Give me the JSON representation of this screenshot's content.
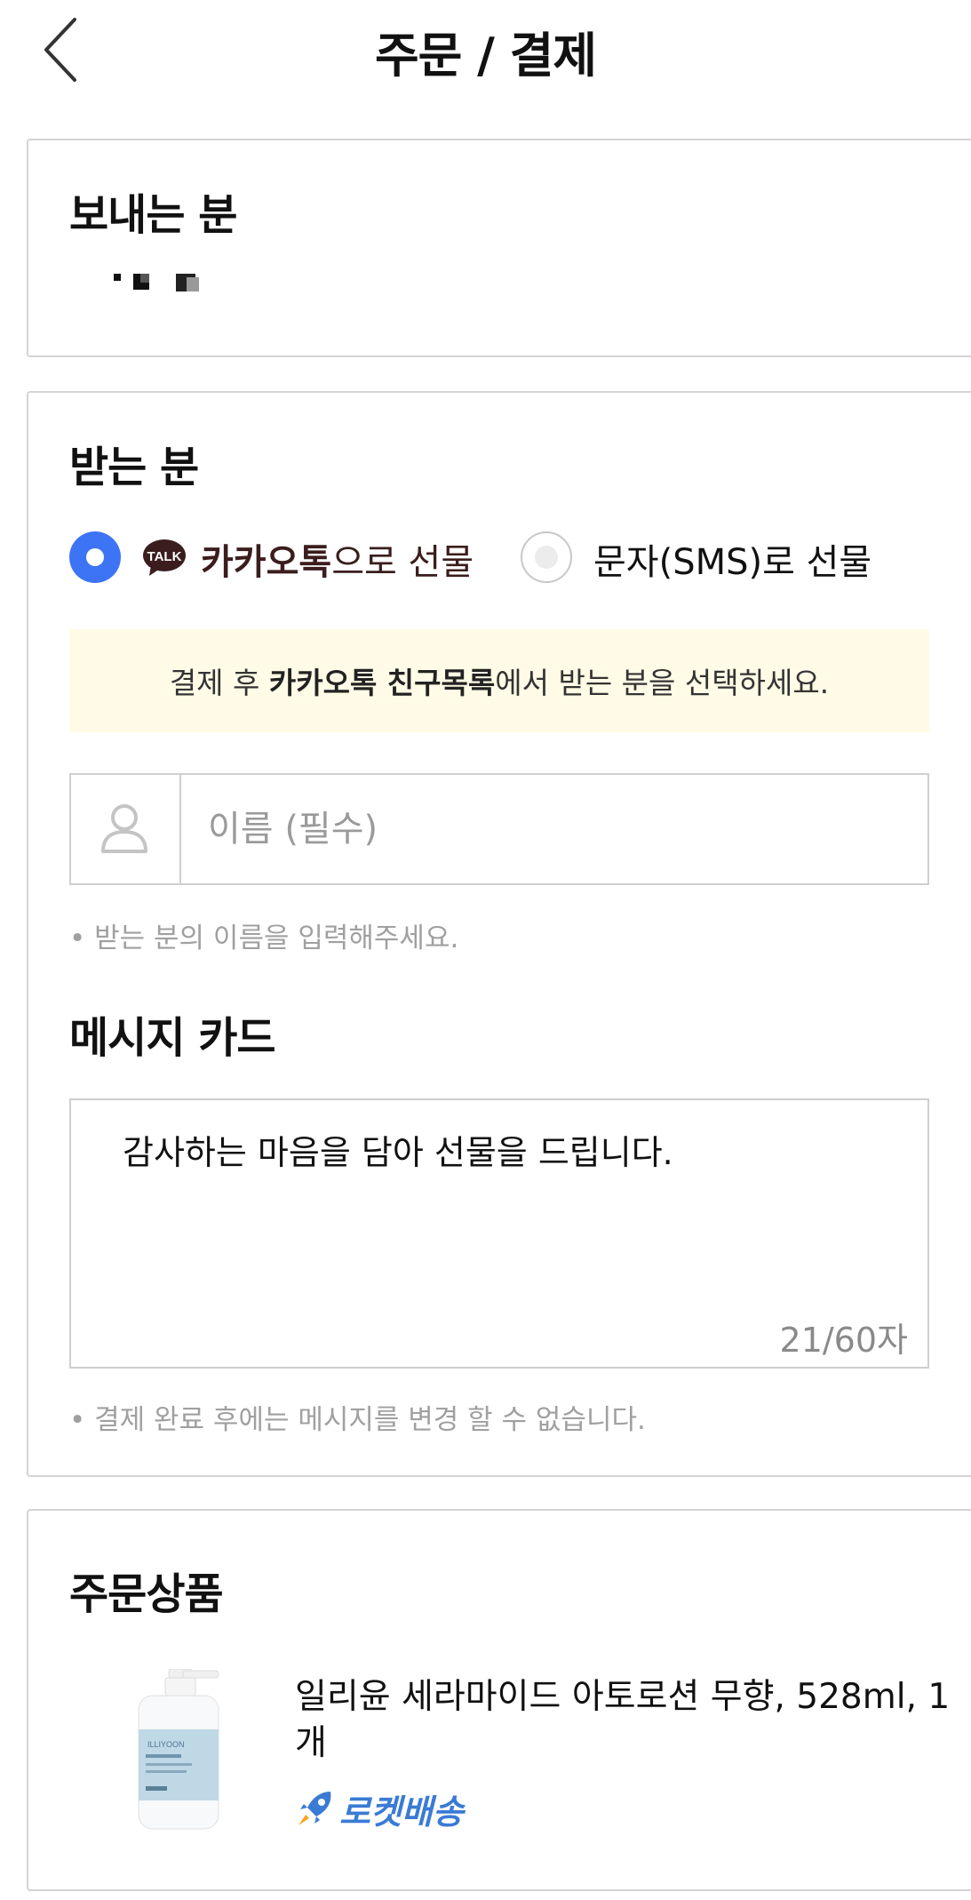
{
  "header": {
    "title": "주문 / 결제"
  },
  "sender": {
    "title": "보내는 분"
  },
  "receiver": {
    "title": "받는 분",
    "option_kakao_bold": "카카오톡",
    "option_kakao_rest": "으로 선물",
    "option_sms": "문자(SMS)로 선물",
    "talk_icon_text": "TALK",
    "selected": "kakao",
    "notice_prefix": "결제 후 ",
    "notice_bold": "카카오톡 친구목록",
    "notice_suffix": "에서 받는 분을 선택하세요.",
    "name_placeholder": "이름 (필수)",
    "name_value": "",
    "name_hint": "• 받는 분의 이름을 입력해주세요."
  },
  "message_card": {
    "title": "메시지 카드",
    "text": "감사하는 마음을 담아 선물을 드립니다.",
    "count": "21/60자",
    "hint": "• 결제 완료 후에는 메시지를 변경 할 수 없습니다."
  },
  "order": {
    "title": "주문상품",
    "product_name": "일리윤 세라마이드 아토로션 무향, 528ml, 1개",
    "delivery_badge": "로켓배송",
    "brand_text": "ILLIYOON"
  },
  "colors": {
    "accent_blue": "#3d74f5",
    "kakao_brown": "#3b1d1d",
    "notice_bg": "#fffbe6",
    "rocket_blue": "#3a7bd5"
  }
}
